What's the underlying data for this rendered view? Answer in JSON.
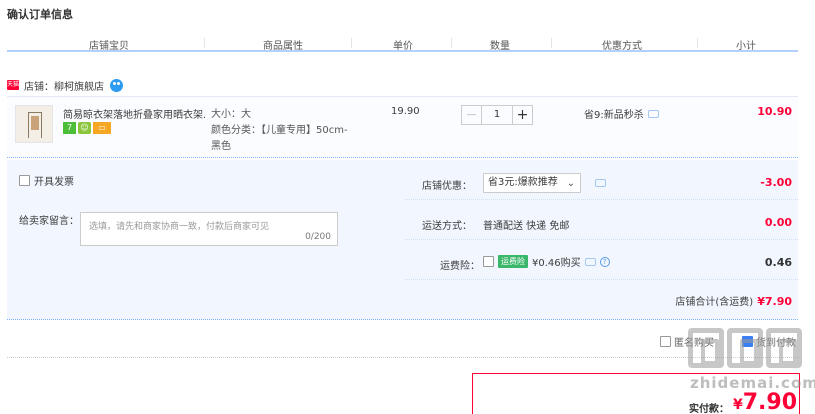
{
  "page": {
    "title": "确认订单信息"
  },
  "columns": [
    "店铺宝贝",
    "商品属性",
    "单价",
    "数量",
    "优惠方式",
    "小计"
  ],
  "shop": {
    "badge": "天猫",
    "label": "店铺：",
    "name": "柳柯旗舰店"
  },
  "item": {
    "name": "简易晾衣架落地折叠家用晒衣架...",
    "badges": [
      "7",
      "☺",
      "▭"
    ],
    "size": "大小：大",
    "color_line1": "颜色分类：【儿童专用】50cm-",
    "color_line2": "黑色",
    "unit_price": "19.90",
    "quantity": "1",
    "minus": "−",
    "plus": "+",
    "promo": "省9:新品秒杀",
    "subtotal": "10.90"
  },
  "options": {
    "invoice_label": "开具发票",
    "memo_label": "给卖家留言：",
    "memo_placeholder": "选填，请先和商家协商一致，付款后商家可见",
    "memo_counter": "0/200",
    "coupon_label": "店铺优惠：",
    "coupon_value": "省3元:爆款推荐",
    "coupon_amount": "-3.00",
    "shipping_label": "运送方式：",
    "shipping_value": "普通配送 快递 免邮",
    "shipping_amount": "0.00",
    "insurance_label": "运费险：",
    "insurance_badge": "运费险",
    "insurance_value": "¥0.46购买",
    "insurance_amount": "0.46",
    "insurance_help": "?",
    "total_label": "店铺合计(含运费)",
    "total_amount": "¥7.90"
  },
  "footer": {
    "anon_label": "匿名购买",
    "cod_label": "货到付款",
    "pay_label": "实付款：",
    "pay_currency": "¥",
    "pay_amount": "7.90"
  },
  "watermark": {
    "text": "zhidemai.com"
  },
  "colors": {
    "accent_red": "#ff0036",
    "border_blue": "#b2d1ff",
    "panel_bg": "#f2f7ff"
  }
}
